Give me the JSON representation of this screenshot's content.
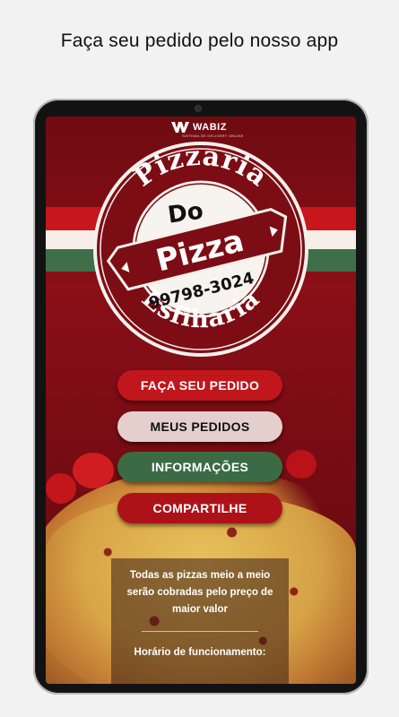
{
  "headline": "Faça seu pedido pelo nosso app",
  "brand": {
    "name": "WABIZ",
    "tagline": "SISTEMA DE DELIVERY ONLINE"
  },
  "logo": {
    "arc_top": "Pizzaria",
    "arc_bottom": "Esfiharia",
    "do": "Do",
    "banner": "Pizza",
    "phone": "99798-3024"
  },
  "buttons": {
    "order": "FAÇA SEU PEDIDO",
    "my_orders": "MEUS PEDIDOS",
    "info": "INFORMAÇÕES",
    "share": "COMPARTILHE"
  },
  "notice": {
    "text": "Todas as pizzas meio a meio serão cobradas pelo preço de maior valor",
    "hours_label": "Horário de funcionamento:"
  },
  "colors": {
    "background_red": "#7a0c14",
    "button_red": "#c0161c",
    "button_light": "#e4cfcd",
    "button_green": "#3a6b45",
    "flag_red": "#c8161d",
    "flag_white": "#f6efe9",
    "flag_green": "#3f6f48"
  }
}
